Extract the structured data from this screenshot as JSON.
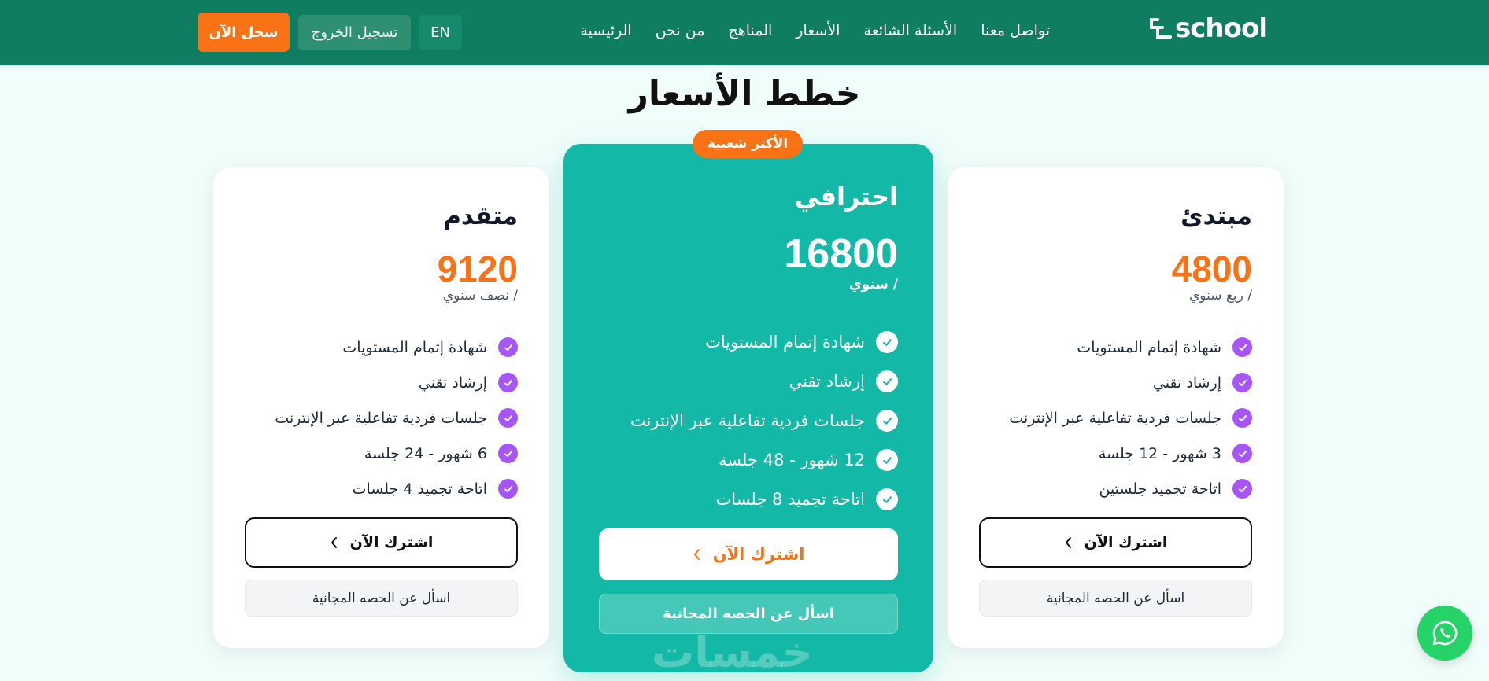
{
  "header": {
    "logo_text": "school",
    "nav": [
      "الرئيسية",
      "من نحن",
      "المناهج",
      "الأسعار",
      "الأسئلة الشائعة",
      "تواصل معنا"
    ],
    "lang_button": "EN",
    "logout_button": "تسجيل الخروج",
    "register_button": "سجل الآن",
    "colors": {
      "header_bg": "#0f7d62",
      "accent": "#f97316"
    }
  },
  "page_title": "خطط الأسعار",
  "plans": {
    "basic": {
      "name": "مبتدئ",
      "price": "4800",
      "period": "/ ربع سنوي",
      "features": [
        "شهادة إتمام المستويات",
        "إرشاد تقني",
        "جلسات فردية تفاعلية عبر الإنترنت",
        "3 شهور - 12 جلسة",
        "اتاحة تجميد جلستين"
      ],
      "subscribe": "اشترك الآن",
      "free_session": "اسأل عن الحصه المجانية"
    },
    "pro": {
      "badge": "الأكثر شعبية",
      "name": "احترافي",
      "price": "16800",
      "period": "/ سنوي",
      "features": [
        "شهادة إتمام المستويات",
        "إرشاد تقني",
        "جلسات فردية تفاعلية عبر الإنترنت",
        "12 شهور - 48 جلسة",
        "اتاحة تجميد 8 جلسات"
      ],
      "subscribe": "اشترك الآن",
      "free_session": "اسأل عن الحصه المجانية"
    },
    "advanced": {
      "name": "متقدم",
      "price": "9120",
      "period": "/ نصف سنوي",
      "features": [
        "شهادة إتمام المستويات",
        "إرشاد تقني",
        "جلسات فردية تفاعلية عبر الإنترنت",
        "6 شهور - 24 جلسة",
        "اتاحة تجميد 4 جلسات"
      ],
      "subscribe": "اشترك الآن",
      "free_session": "اسأل عن الحصه المجانية"
    }
  },
  "watermark": "خمسات",
  "icons": {
    "check": "check-icon",
    "chevron": "chevron-left-icon",
    "whatsapp": "whatsapp-icon"
  }
}
